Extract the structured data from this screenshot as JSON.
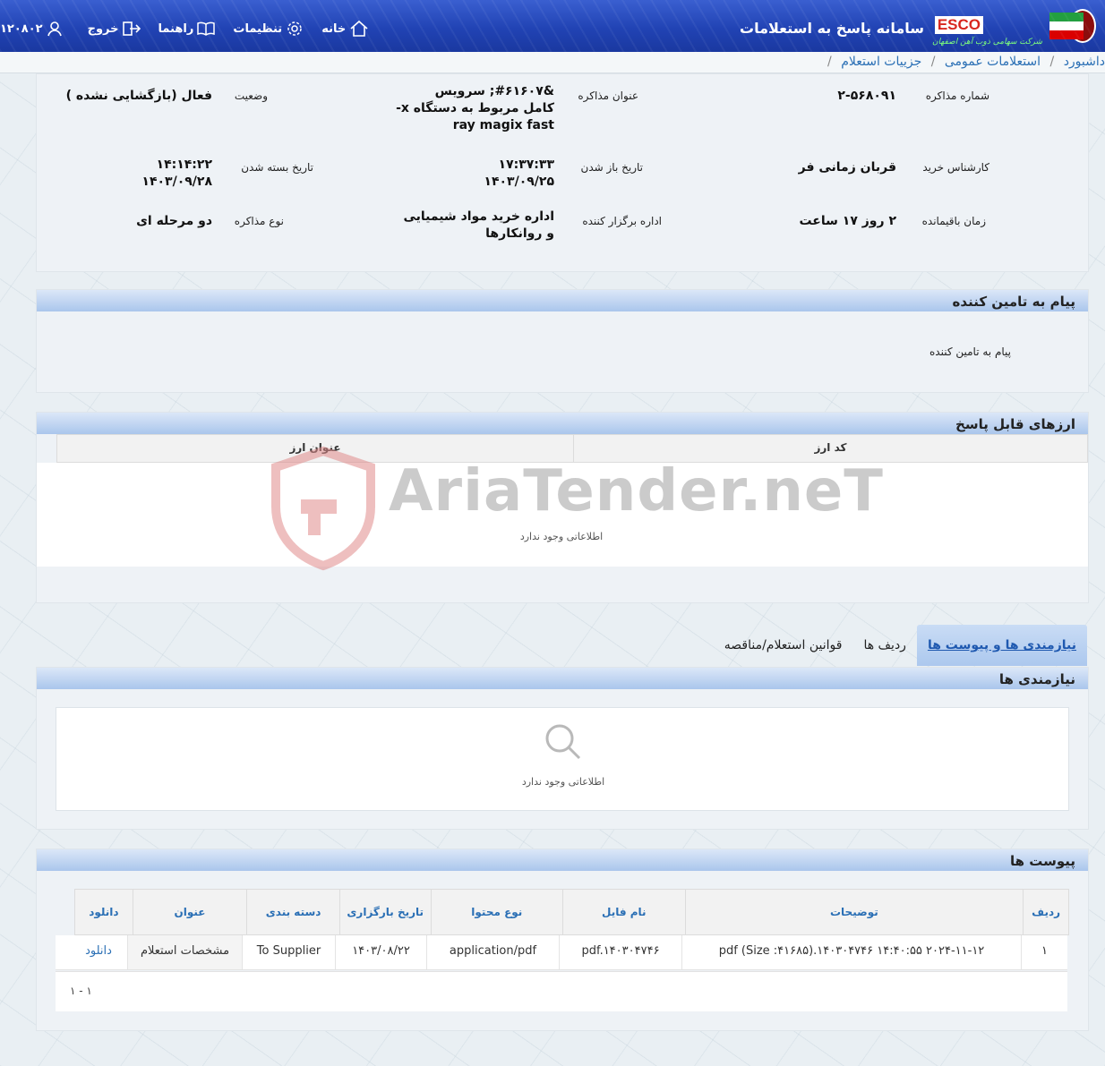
{
  "header": {
    "system_name": "سامانه پاسخ به استعلامات",
    "logo_text": "ESCO",
    "company_name": "شرکت سهامی ذوب آهن اصفهان",
    "nav": {
      "home": "خانه",
      "settings": "تنظیمات",
      "guide": "راهنما",
      "logout": "خروج",
      "user_id": "۱۲۰۸۰۲"
    }
  },
  "breadcrumb": {
    "dashboard": "داشبورد",
    "general": "استعلامات عمومی",
    "current": "جزییات استعلام",
    "separator": "/"
  },
  "details": {
    "negotiation_number_label": "شماره مذاکره",
    "negotiation_number": "۲-۵۶۸۰۹۱",
    "title_label": "عنوان مذاکره",
    "title_line1": "&#۶۱۶۰۷; سرویس",
    "title_line2": "کامل مربوط به دستگاه x-",
    "title_line3": "ray magix fast",
    "status_label": "وضعیت",
    "status": "فعال (بازگشایی نشده )",
    "buyer_expert_label": "کارشناس خرید",
    "buyer_expert": "قربان زمانی فر",
    "open_date_label": "تاریخ باز شدن",
    "open_time": "۱۷:۳۷:۳۳",
    "open_date": "۱۴۰۳/۰۹/۲۵",
    "close_date_label": "تاریخ بسته شدن",
    "close_time": "۱۴:۱۴:۲۲",
    "close_date": "۱۴۰۳/۰۹/۲۸",
    "remaining_label": "زمان باقیمانده",
    "remaining": "۲ روز ۱۷ ساعت",
    "organizer_label": "اداره برگزار کننده",
    "organizer_line1": "اداره خرید مواد شیمیایی",
    "organizer_line2": "و روانکارها",
    "type_label": "نوع مذاکره",
    "type": "دو مرحله ای"
  },
  "supplier_message": {
    "heading": "پیام به تامین کننده",
    "label": "پیام به تامین کننده"
  },
  "currencies": {
    "heading": "ارزهای قابل پاسخ",
    "col_code": "کد ارز",
    "col_title": "عنوان ارز",
    "empty_text": "اطلاعاتی وجود ندارد"
  },
  "tabs": [
    {
      "label": "نیازمندی ها و پیوست ها"
    },
    {
      "label": "ردیف ها"
    },
    {
      "label": "قوانین استعلام/مناقصه"
    }
  ],
  "requirements": {
    "heading": "نیازمندی ها",
    "empty_text": "اطلاعاتی وجود ندارد"
  },
  "attachments": {
    "heading": "پیوست ها",
    "columns": {
      "row": "ردیف",
      "description": "توضیحات",
      "file_name": "نام فایل",
      "content_type": "نوع محتوا",
      "upload_date": "تاریخ بارگزاری",
      "category": "دسته بندی",
      "title": "عنوان",
      "download": "دانلود"
    },
    "rows": [
      {
        "row": "۱",
        "description": "pdf (Size :۴۱۶۸۵).۱۴۰۳۰۴۷۴۶ ۱۴:۴۰:۵۵ ۲۰۲۴-۱۱-۱۲",
        "file_name": "pdf.۱۴۰۳۰۴۷۴۶",
        "content_type": "application/pdf",
        "upload_date": "۱۴۰۳/۰۸/۲۲",
        "category": "To Supplier",
        "title": "مشخصات استعلام",
        "download": "دانلود"
      }
    ],
    "pager": "۱ - ۱"
  },
  "watermark": "AriaTender.neT",
  "colors": {
    "header_blue": "#2143b4",
    "panel_head": "#aac6ec",
    "link_blue": "#2a6fb5",
    "logo_red": "#d8241c",
    "watermark_red": "#e08a8a"
  }
}
